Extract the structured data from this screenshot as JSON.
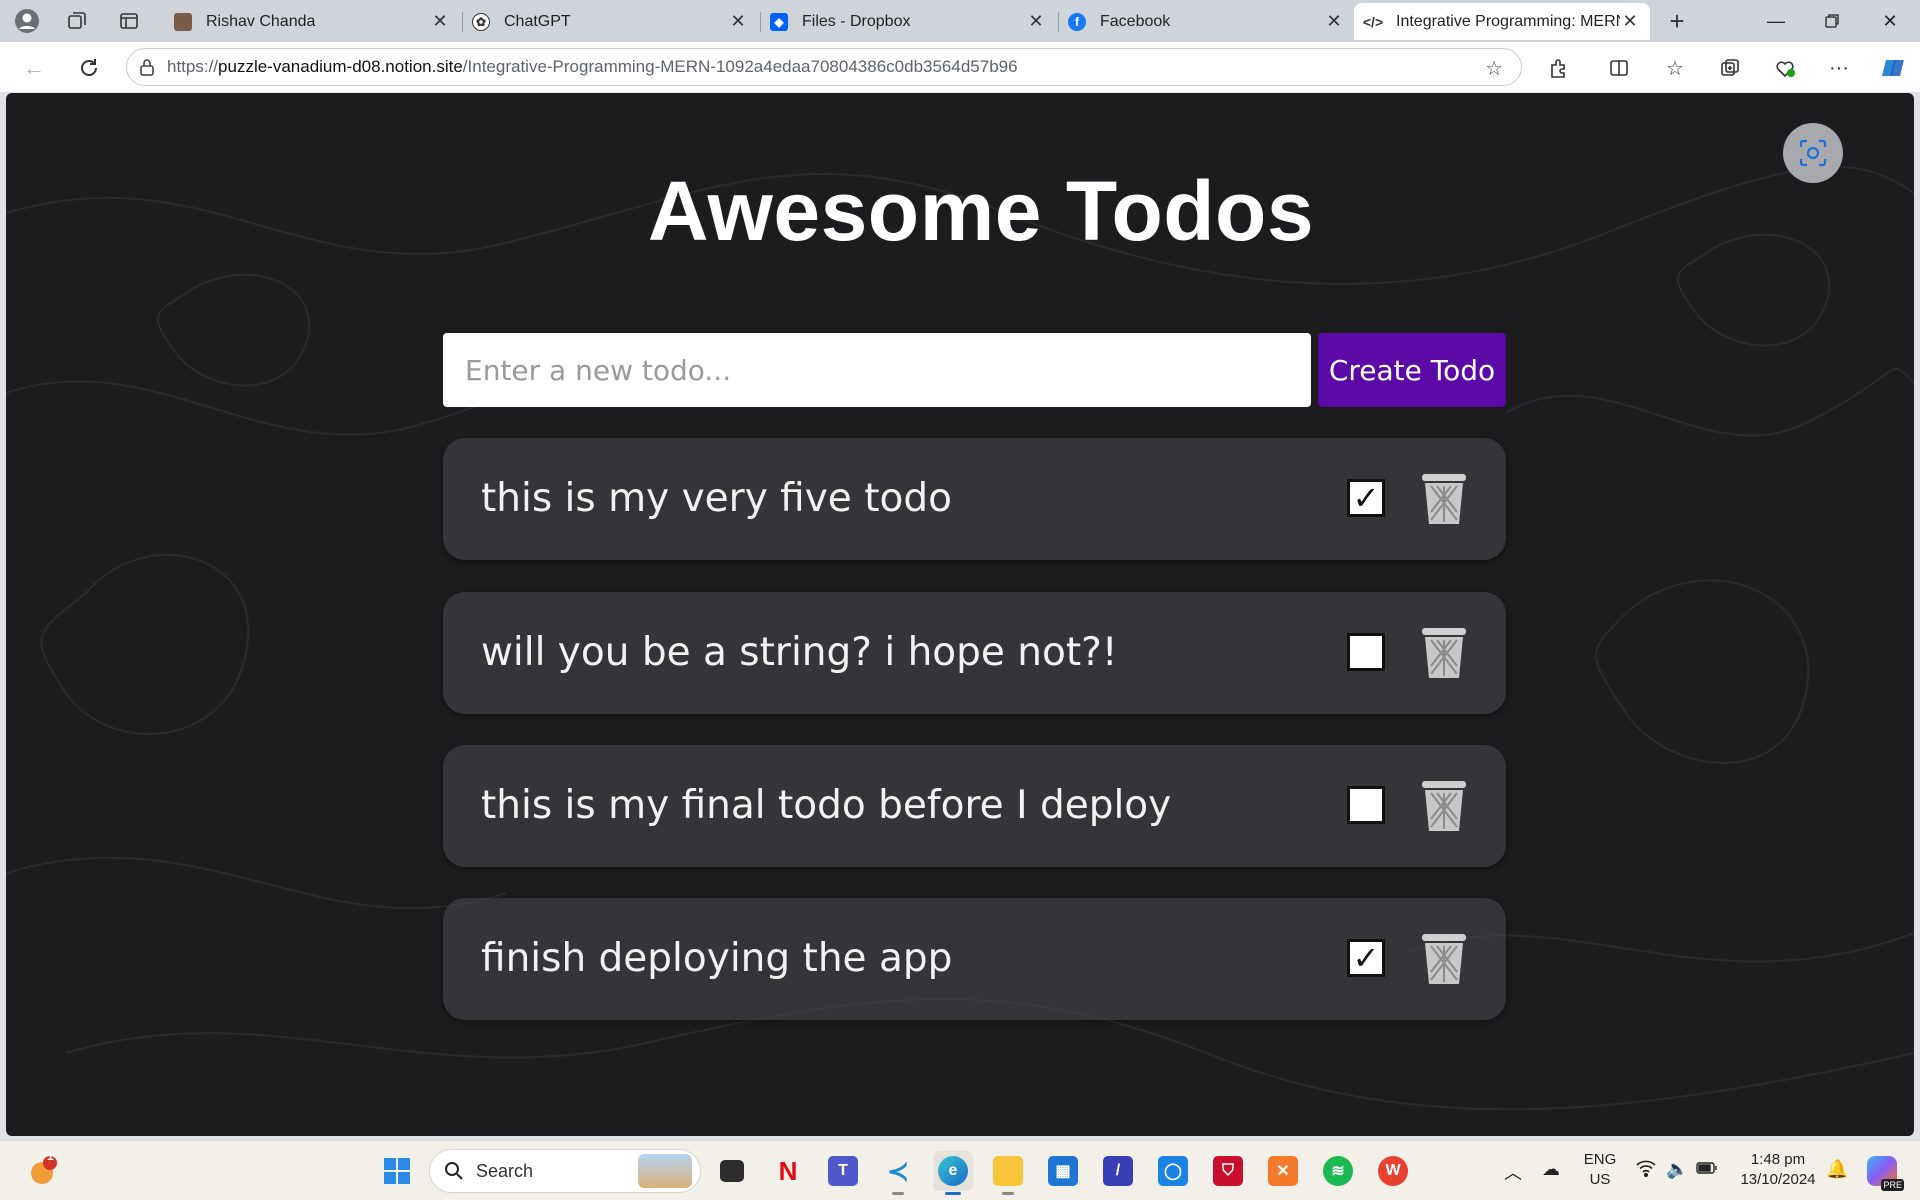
{
  "browser": {
    "tabs": [
      {
        "title": "Rishav Chanda",
        "active": false,
        "icon": "profile-photo-icon"
      },
      {
        "title": "ChatGPT",
        "active": false,
        "icon": "chatgpt-icon"
      },
      {
        "title": "Files - Dropbox",
        "active": false,
        "icon": "dropbox-icon"
      },
      {
        "title": "Facebook",
        "active": false,
        "icon": "facebook-icon"
      },
      {
        "title": "Integrative Programming: MERN",
        "active": true,
        "icon": "code-icon"
      }
    ],
    "address": {
      "prefix": "https://",
      "host": "puzzle-vanadium-d08.notion.site",
      "path": "/Integrative-Programming-MERN-1092a4edaa70804386c0db3564d57b96"
    }
  },
  "app": {
    "title": "Awesome Todos",
    "input_placeholder": "Enter a new todo...",
    "create_button": "Create Todo",
    "todos": [
      {
        "text": "this is my very five todo",
        "checked": true,
        "check_mark": "✓"
      },
      {
        "text": "will you be a string? i hope not?!",
        "checked": false,
        "check_mark": ""
      },
      {
        "text": "this is my final todo before I deploy",
        "checked": false,
        "check_mark": ""
      },
      {
        "text": "finish deploying the app",
        "checked": true,
        "check_mark": "✓"
      }
    ]
  },
  "taskbar": {
    "search_label": "Search",
    "notification_count": "1",
    "language_line1": "ENG",
    "language_line2": "US",
    "time": "1:48 pm",
    "date": "13/10/2024",
    "copilot_badge": "PRE"
  },
  "colors": {
    "page_background": "#1c1b1d",
    "create_button": "#5b0aa8",
    "card_background": "#464448"
  }
}
